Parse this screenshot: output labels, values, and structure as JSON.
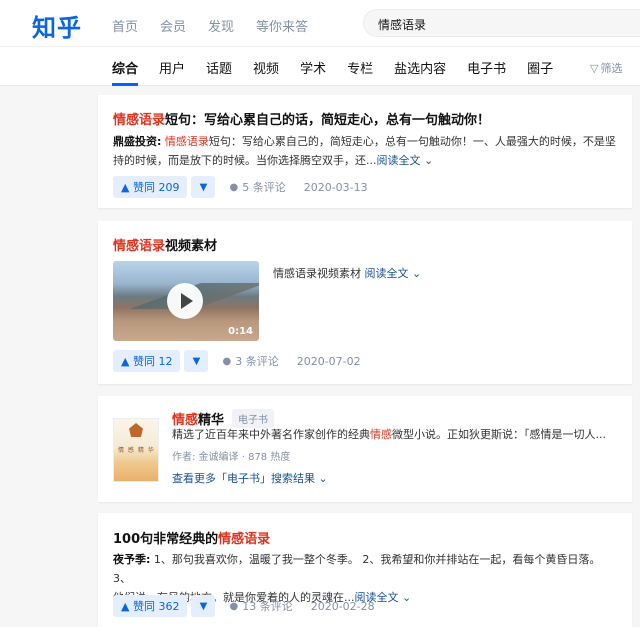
{
  "header": {
    "logo": "知乎",
    "nav": [
      "首页",
      "会员",
      "发现",
      "等你来答"
    ],
    "search_value": "情感语录"
  },
  "tabs": {
    "items": [
      "综合",
      "用户",
      "话题",
      "视频",
      "学术",
      "专栏",
      "盐选内容",
      "电子书",
      "圈子"
    ],
    "active": "综合",
    "filter_label": "筛选"
  },
  "results": {
    "r1": {
      "title_hl": "情感语录",
      "title_rest": "短句：写给心累自己的话，简短走心，总有一句触动你！",
      "author": "鼎盛投资:",
      "excerpt_hl": "情感语录",
      "excerpt_line1_rest": "短句：写给心累自己的，简短走心，总有一句触动你！一、人最强大的时候，不是坚",
      "excerpt_line2": "持的时候，而是放下的时候。当你选择腾空双手，还...",
      "read_more": "阅读全文",
      "vote": "赞同 209",
      "comments": "5 条评论",
      "date": "2020-03-13"
    },
    "r2": {
      "title_hl": "情感语录",
      "title_rest": "视频素材",
      "video_text": "情感语录视频素材",
      "read_more": "阅读全文",
      "duration": "0:14",
      "vote": "赞同 12",
      "comments": "3 条评论",
      "date": "2020-07-02"
    },
    "r3": {
      "title_hl": "情感",
      "title_rest": "精华",
      "badge": "电子书",
      "desc_pre": "精选了近百年来中外著名作家创作的经典",
      "desc_hl": "情感",
      "desc_post": "微型小说。正如狄更斯说：「感情是一切人...",
      "meta": "作者: 金诚编译 · 878 热度",
      "more": "查看更多「电子书」搜索结果"
    },
    "r4": {
      "title_pre": "100句非常经典的",
      "title_hl": "情感语录",
      "author": "夜予季:",
      "excerpt_line1": "1、那句我喜欢你，温暖了我一整个冬季。 2、我希望和你并排站在一起，看每个黄昏日落。 3、",
      "excerpt_line2": "他们说，有风的地方。就是你爱着的人的灵魂在...",
      "read_more": "阅读全文",
      "vote": "赞同 362",
      "comments": "13 条评论",
      "date": "2020-02-28"
    }
  }
}
